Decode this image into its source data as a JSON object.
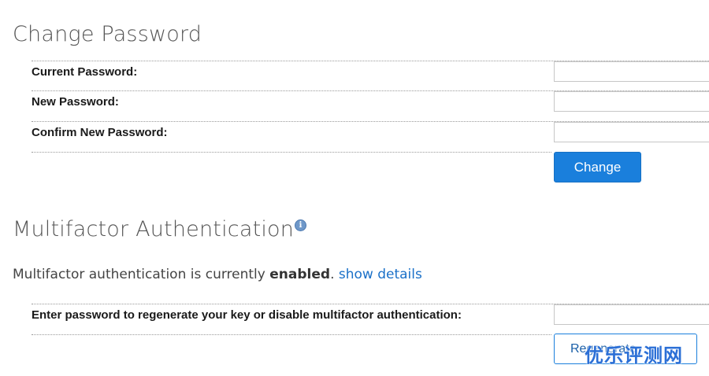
{
  "change_password": {
    "title": "Change Password",
    "fields": [
      {
        "label": "Current Password:",
        "value": ""
      },
      {
        "label": "New Password:",
        "value": ""
      },
      {
        "label": "Confirm New Password:",
        "value": ""
      }
    ],
    "submit_label": "Change"
  },
  "mfa": {
    "title": "Multifactor Authentication",
    "info_icon": "info-icon",
    "status_prefix": "Multifactor authentication is currently",
    "status_value": "enabled",
    "status_suffix": ".",
    "show_details_link": "show details",
    "regenerate_label": "Enter password to regenerate your key or disable multifactor authentication:",
    "regenerate_value": "",
    "regenerate_button": "Regenerate"
  },
  "watermark": "优乐评测网",
  "colors": {
    "accent": "#1a7fdc",
    "link": "#1a70c8",
    "heading": "#555555"
  }
}
